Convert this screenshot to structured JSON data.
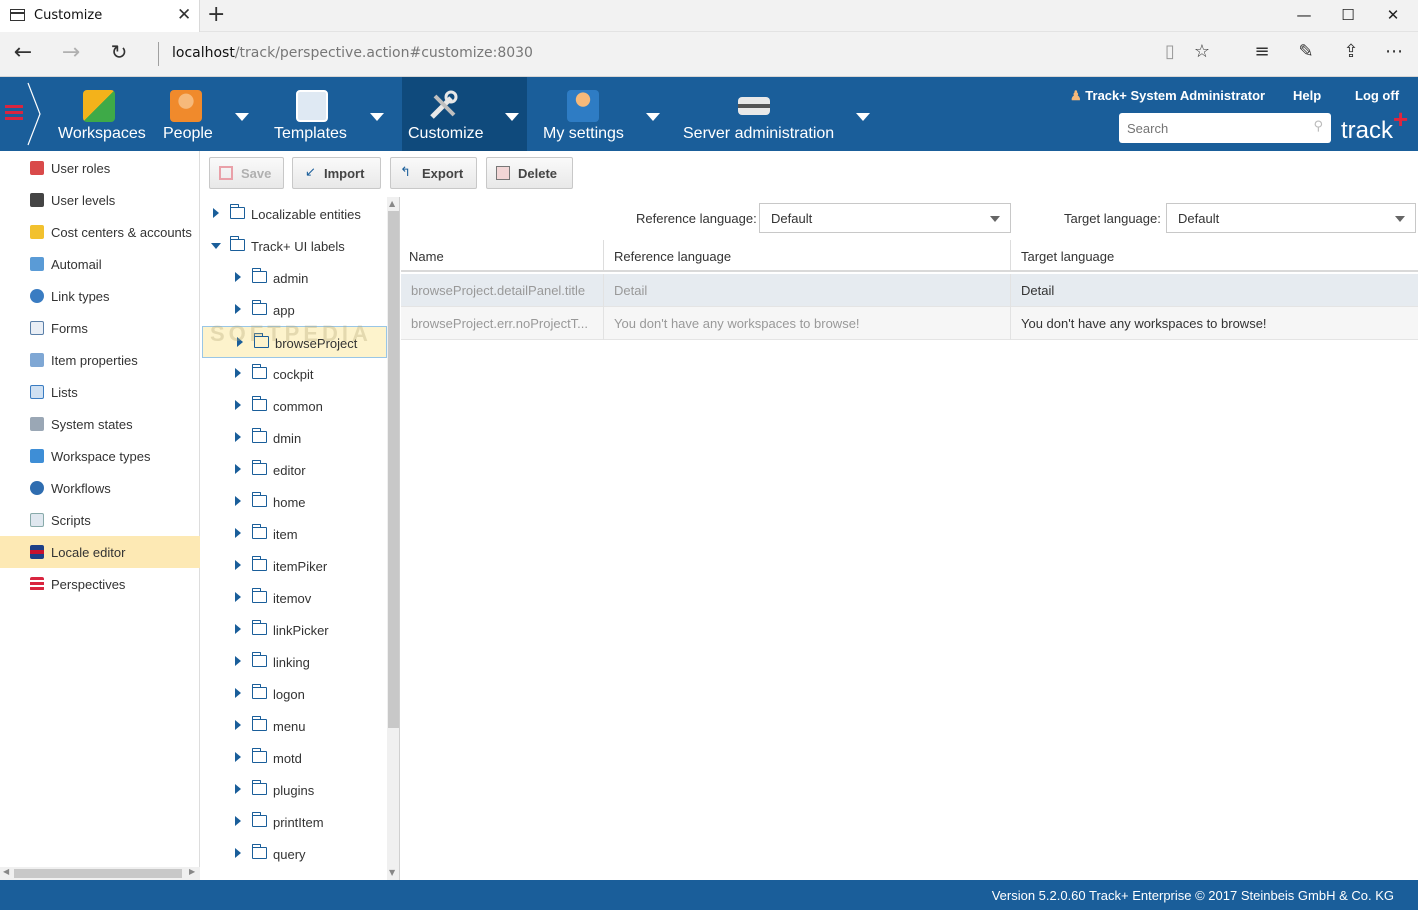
{
  "browser": {
    "tab_title": "Customize",
    "url_host": "localhost",
    "url_rest": "/track/perspective.action#customize:8030"
  },
  "header": {
    "menu": [
      {
        "label": "Workspaces",
        "icon": "puzzle-icon"
      },
      {
        "label": "People",
        "icon": "people-icon"
      },
      {
        "label": "Templates",
        "icon": "templates-icon"
      },
      {
        "label": "Customize",
        "icon": "tools-icon"
      },
      {
        "label": "My settings",
        "icon": "user-settings-icon"
      },
      {
        "label": "Server administration",
        "icon": "server-icon"
      }
    ],
    "user": "Track+ System Administrator",
    "help": "Help",
    "logoff": "Log off",
    "search_placeholder": "Search",
    "brand": "track",
    "brand_plus": "+",
    "colors": {
      "header": "#1a5e9a",
      "active": "#0f4a7c",
      "accent": "#e2253c"
    }
  },
  "leftnav": {
    "items": [
      {
        "label": "User roles",
        "icon": "user-roles-icon"
      },
      {
        "label": "User levels",
        "icon": "user-levels-icon"
      },
      {
        "label": "Cost centers & accounts",
        "icon": "cost-centers-icon"
      },
      {
        "label": "Automail",
        "icon": "automail-icon"
      },
      {
        "label": "Link types",
        "icon": "link-icon"
      },
      {
        "label": "Forms",
        "icon": "forms-icon"
      },
      {
        "label": "Item properties",
        "icon": "item-properties-icon"
      },
      {
        "label": "Lists",
        "icon": "lists-icon"
      },
      {
        "label": "System states",
        "icon": "system-states-icon"
      },
      {
        "label": "Workspace types",
        "icon": "puzzle-icon"
      },
      {
        "label": "Workflows",
        "icon": "workflow-icon"
      },
      {
        "label": "Scripts",
        "icon": "scripts-icon"
      },
      {
        "label": "Locale editor",
        "icon": "flag-icon",
        "selected": true
      },
      {
        "label": "Perspectives",
        "icon": "perspectives-icon"
      }
    ]
  },
  "toolbar": {
    "save": "Save",
    "import": "Import",
    "export": "Export",
    "delete": "Delete"
  },
  "tree": {
    "root1": "Localizable entities",
    "root2": "Track+ UI labels",
    "children": [
      "admin",
      "app",
      "browseProject",
      "cockpit",
      "common",
      "dmin",
      "editor",
      "home",
      "item",
      "itemPiker",
      "itemov",
      "linkPicker",
      "linking",
      "logon",
      "menu",
      "motd",
      "plugins",
      "printItem",
      "query"
    ],
    "selected": "browseProject"
  },
  "grid": {
    "ref_lang_label": "Reference language:",
    "ref_lang_value": "Default",
    "target_lang_label": "Target language:",
    "target_lang_value": "Default",
    "columns": [
      "Name",
      "Reference language",
      "Target language"
    ],
    "rows": [
      {
        "name": "browseProject.detailPanel.title",
        "ref": "Detail",
        "target": "Detail"
      },
      {
        "name": "browseProject.err.noProjectT...",
        "ref": "You don't have any workspaces to browse!",
        "target": "You don't have any workspaces to browse!"
      }
    ]
  },
  "footer": {
    "text": "Version 5.2.0.60 Track+ Enterprise   © 2017 Steinbeis GmbH & Co. KG"
  },
  "watermark": "SOFTPEDIA"
}
